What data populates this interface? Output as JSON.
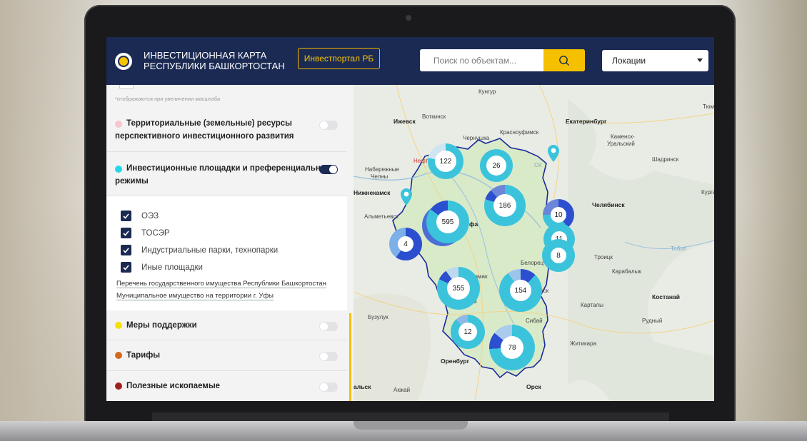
{
  "header": {
    "title_line1": "ИНВЕСТИЦИОННАЯ КАРТА",
    "title_line2": "РЕСПУБЛИКИ БАШКОРТОСТАН",
    "portal_button": "Инвестпортал РБ",
    "search": {
      "placeholder": "Поиск по объектам..."
    },
    "location_select": "Локации"
  },
  "sidebar": {
    "note": "*отображаются при увеличении масштаба",
    "sections": [
      {
        "title_line1": "Территориальные (земельные) ресурсы",
        "title_line2": "перспективного инвестиционного развития",
        "dot_color": "#f7c6cf",
        "enabled": false
      },
      {
        "title_line1": "Инвестиционные площадки и преференциальные",
        "title_line2": "режимы",
        "dot_color": "#22d8e6",
        "enabled": true
      }
    ],
    "checkboxes": [
      {
        "label": "ОЭЗ",
        "checked": true
      },
      {
        "label": "ТОСЭР",
        "checked": true
      },
      {
        "label": "Индустриальные парки, технопарки",
        "checked": true
      },
      {
        "label": "Иные площадки",
        "checked": true
      }
    ],
    "links": [
      "Перечень государственного имущества Республики Башкортостан",
      "Муниципальное имущество на территории г. Уфы"
    ],
    "layers": [
      {
        "title": "Меры поддержки",
        "dot_color": "#f5e000",
        "enabled": false
      },
      {
        "title": "Тарифы",
        "dot_color": "#d26a1e",
        "enabled": false
      },
      {
        "title": "Полезные ископаемые",
        "dot_color": "#a01f1f",
        "enabled": false
      }
    ]
  },
  "map": {
    "labels": [
      "Кунгур",
      "Ижевск",
      "Воткинск",
      "Екатеринбург",
      "Чернушка",
      "Красноуфимск",
      "Каменск-",
      "Уральский",
      "Шадринск",
      "Набережные",
      "Челны",
      "Нижнекамск",
      "Нефт",
      "Альметьевск",
      "Челябинск",
      "Курга",
      "Тюм",
      "фа",
      "Белорец",
      "Троицк",
      "Карабалык",
      "тамак",
      "тогорск",
      "Костанай",
      "Карталы",
      "Рудный",
      "Бузулук",
      "Житикара",
      "Оренбург",
      "Орск",
      "Акжай",
      "альск",
      "Сибай",
      "ав",
      "Тобол",
      "СК"
    ],
    "clusters": [
      {
        "count": "122"
      },
      {
        "count": "26"
      },
      {
        "count": "186"
      },
      {
        "count": "595"
      },
      {
        "count": "10"
      },
      {
        "count": "11"
      },
      {
        "count": "8"
      },
      {
        "count": "4"
      },
      {
        "count": "355"
      },
      {
        "count": "154"
      },
      {
        "count": "12"
      },
      {
        "count": "78"
      }
    ]
  },
  "colors": {
    "header_bg": "#1b2a53",
    "accent_yellow": "#f5c000",
    "cluster_cyan": "#3bc3dc",
    "cluster_blue": "#2b4fcf"
  }
}
